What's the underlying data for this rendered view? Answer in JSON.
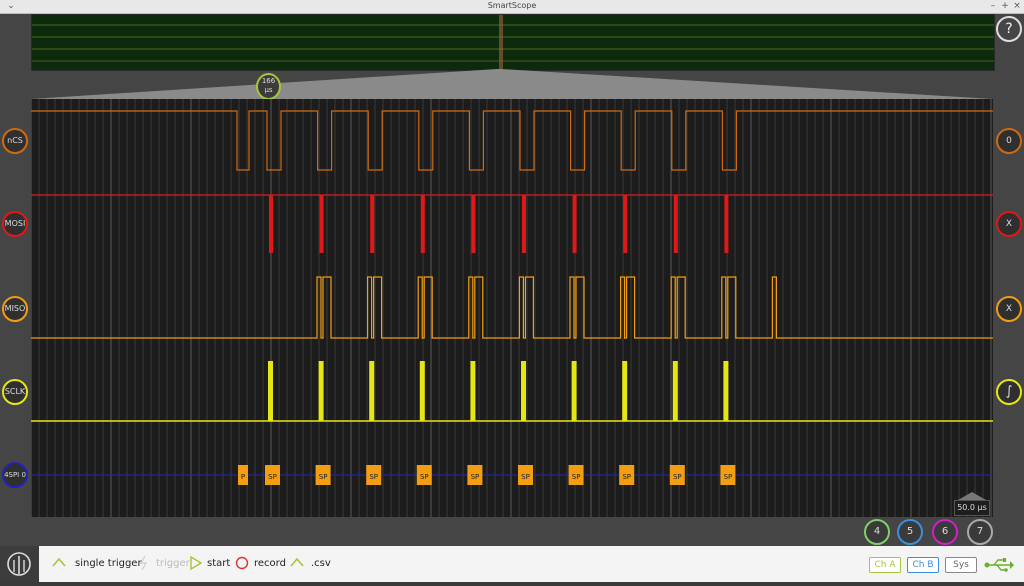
{
  "window": {
    "title": "SmartScope",
    "minimize": "–",
    "maximize": "+",
    "close": "×"
  },
  "help": {
    "label": "?"
  },
  "zoom_badge": {
    "value": "166",
    "unit": "µs"
  },
  "channels": [
    {
      "id": "ncs",
      "label": "nCS",
      "right_label": "0",
      "color": "#d06a10"
    },
    {
      "id": "mosi",
      "label": "MOSI",
      "right_label": "X",
      "color": "#e01818"
    },
    {
      "id": "miso",
      "label": "MISO",
      "right_label": "X",
      "color": "#f29d12"
    },
    {
      "id": "sclk",
      "label": "SCLK",
      "right_label": "∫",
      "color": "#e6e615"
    },
    {
      "id": "spi",
      "label": "4SPI 0",
      "right_label": "",
      "color": "#2222bb"
    }
  ],
  "decoder_packets": [
    "P",
    "SP",
    "SP",
    "SP",
    "SP",
    "SP",
    "SP",
    "SP",
    "SP",
    "SP",
    "SP"
  ],
  "timebase": {
    "label": "50.0 µs"
  },
  "channel_buttons": [
    {
      "label": "4",
      "color": "#7fcf6a"
    },
    {
      "label": "5",
      "color": "#3a8fe0"
    },
    {
      "label": "6",
      "color": "#d020c8"
    },
    {
      "label": "7",
      "color": "#aaaaaa"
    }
  ],
  "toolbar": {
    "single_trigger": "single trigger",
    "trigger": "trigger",
    "start": "start",
    "record": "record",
    "csv": ".csv",
    "ch_a": "Ch A",
    "ch_b": "Ch B",
    "sys": "Sys"
  },
  "colors": {
    "ch_a": "#a7c63a",
    "ch_b": "#3a8fe0",
    "sys": "#888888",
    "usb": "#6ab02c",
    "record": "#e03030",
    "start": "#a7c63a"
  }
}
